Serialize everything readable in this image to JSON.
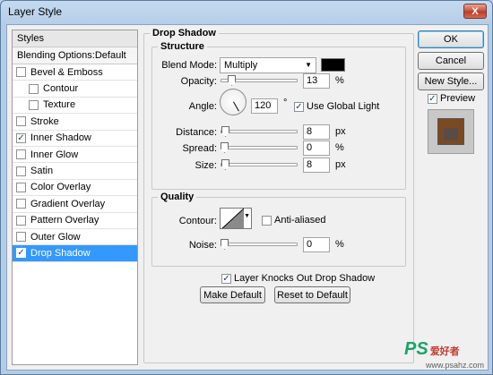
{
  "window": {
    "title": "Layer Style",
    "close_label": "X"
  },
  "styles_panel": {
    "header": "Styles",
    "blending_options": "Blending Options:Default",
    "items": [
      {
        "label": "Bevel & Emboss",
        "checked": false,
        "sub": false
      },
      {
        "label": "Contour",
        "checked": false,
        "sub": true
      },
      {
        "label": "Texture",
        "checked": false,
        "sub": true
      },
      {
        "label": "Stroke",
        "checked": false,
        "sub": false
      },
      {
        "label": "Inner Shadow",
        "checked": true,
        "sub": false
      },
      {
        "label": "Inner Glow",
        "checked": false,
        "sub": false
      },
      {
        "label": "Satin",
        "checked": false,
        "sub": false
      },
      {
        "label": "Color Overlay",
        "checked": false,
        "sub": false
      },
      {
        "label": "Gradient Overlay",
        "checked": false,
        "sub": false
      },
      {
        "label": "Pattern Overlay",
        "checked": false,
        "sub": false
      },
      {
        "label": "Outer Glow",
        "checked": false,
        "sub": false
      },
      {
        "label": "Drop Shadow",
        "checked": true,
        "sub": false,
        "selected": true
      }
    ]
  },
  "drop_shadow": {
    "title": "Drop Shadow",
    "structure": {
      "title": "Structure",
      "blend_mode_label": "Blend Mode:",
      "blend_mode_value": "Multiply",
      "shadow_color": "#000000",
      "opacity_label": "Opacity:",
      "opacity_value": "13",
      "opacity_unit": "%",
      "angle_label": "Angle:",
      "angle_value": "120",
      "angle_unit": "°",
      "global_light_label": "Use Global Light",
      "global_light_checked": true,
      "distance_label": "Distance:",
      "distance_value": "8",
      "distance_unit": "px",
      "spread_label": "Spread:",
      "spread_value": "0",
      "spread_unit": "%",
      "size_label": "Size:",
      "size_value": "8",
      "size_unit": "px"
    },
    "quality": {
      "title": "Quality",
      "contour_label": "Contour:",
      "anti_aliased_label": "Anti-aliased",
      "anti_aliased_checked": false,
      "noise_label": "Noise:",
      "noise_value": "0",
      "noise_unit": "%"
    },
    "knocks_out_label": "Layer Knocks Out Drop Shadow",
    "knocks_out_checked": true,
    "make_default_label": "Make Default",
    "reset_default_label": "Reset to Default"
  },
  "actions": {
    "ok_label": "OK",
    "cancel_label": "Cancel",
    "new_style_label": "New Style...",
    "preview_label": "Preview",
    "preview_checked": true
  },
  "watermark": {
    "brand": "PS",
    "chinese": "爱好者",
    "url": "www.psahz.com"
  }
}
